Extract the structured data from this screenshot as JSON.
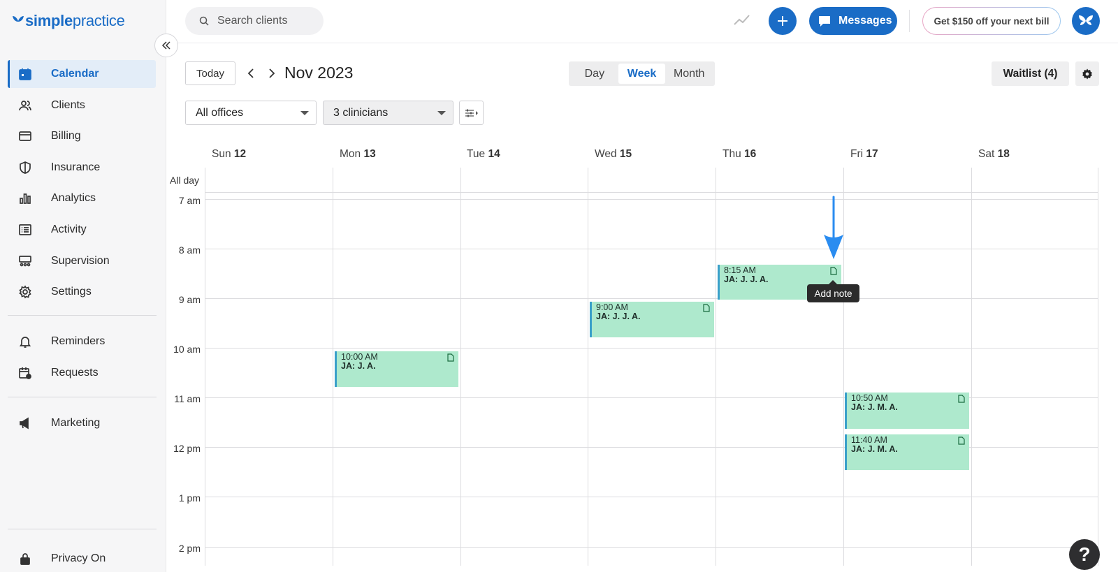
{
  "brand": {
    "logo_bold": "simple",
    "logo_light": "practice"
  },
  "sidebar": {
    "items": [
      {
        "label": "Calendar",
        "icon": "calendar-icon",
        "active": true
      },
      {
        "label": "Clients",
        "icon": "clients-icon"
      },
      {
        "label": "Billing",
        "icon": "credit-card-icon"
      },
      {
        "label": "Insurance",
        "icon": "shield-icon"
      },
      {
        "label": "Analytics",
        "icon": "bar-chart-icon"
      },
      {
        "label": "Activity",
        "icon": "list-icon"
      },
      {
        "label": "Supervision",
        "icon": "supervision-icon"
      },
      {
        "label": "Settings",
        "icon": "gear-icon"
      },
      {
        "label": "Reminders",
        "icon": "bell-icon"
      },
      {
        "label": "Requests",
        "icon": "calendar-request-icon"
      },
      {
        "label": "Marketing",
        "icon": "megaphone-icon"
      }
    ],
    "privacy_label": "Privacy On"
  },
  "topbar": {
    "search_placeholder": "Search clients",
    "messages_label": "Messages",
    "promo_label": "Get $150 off your next bill"
  },
  "calendar": {
    "today_label": "Today",
    "month_title": "Nov 2023",
    "views": {
      "day": "Day",
      "week": "Week",
      "month": "Month",
      "selected": "Week"
    },
    "waitlist_label": "Waitlist (4)",
    "office_select": "All offices",
    "clinician_select": "3 clinicians",
    "allday_label": "All day",
    "days": [
      {
        "dow": "Sun",
        "date": "12"
      },
      {
        "dow": "Mon",
        "date": "13"
      },
      {
        "dow": "Tue",
        "date": "14"
      },
      {
        "dow": "Wed",
        "date": "15"
      },
      {
        "dow": "Thu",
        "date": "16"
      },
      {
        "dow": "Fri",
        "date": "17"
      },
      {
        "dow": "Sat",
        "date": "18"
      }
    ],
    "hours": [
      "7 am",
      "8 am",
      "9 am",
      "10 am",
      "11 am",
      "12 pm",
      "1 pm",
      "2 pm"
    ],
    "events": [
      {
        "time": "8:15 AM",
        "name": "JA: J. J. A."
      },
      {
        "time": "9:00 AM",
        "name": "JA: J. J. A."
      },
      {
        "time": "10:00 AM",
        "name": "JA: J. A."
      },
      {
        "time": "10:50 AM",
        "name": "JA: J. M. A."
      },
      {
        "time": "11:40 AM",
        "name": "JA: J. M. A."
      }
    ],
    "tooltip": "Add note"
  },
  "help_label": "?",
  "colors": {
    "accent": "#1a6cc6",
    "event_bg": "#aee9cd",
    "event_border": "#3aa0c9"
  }
}
